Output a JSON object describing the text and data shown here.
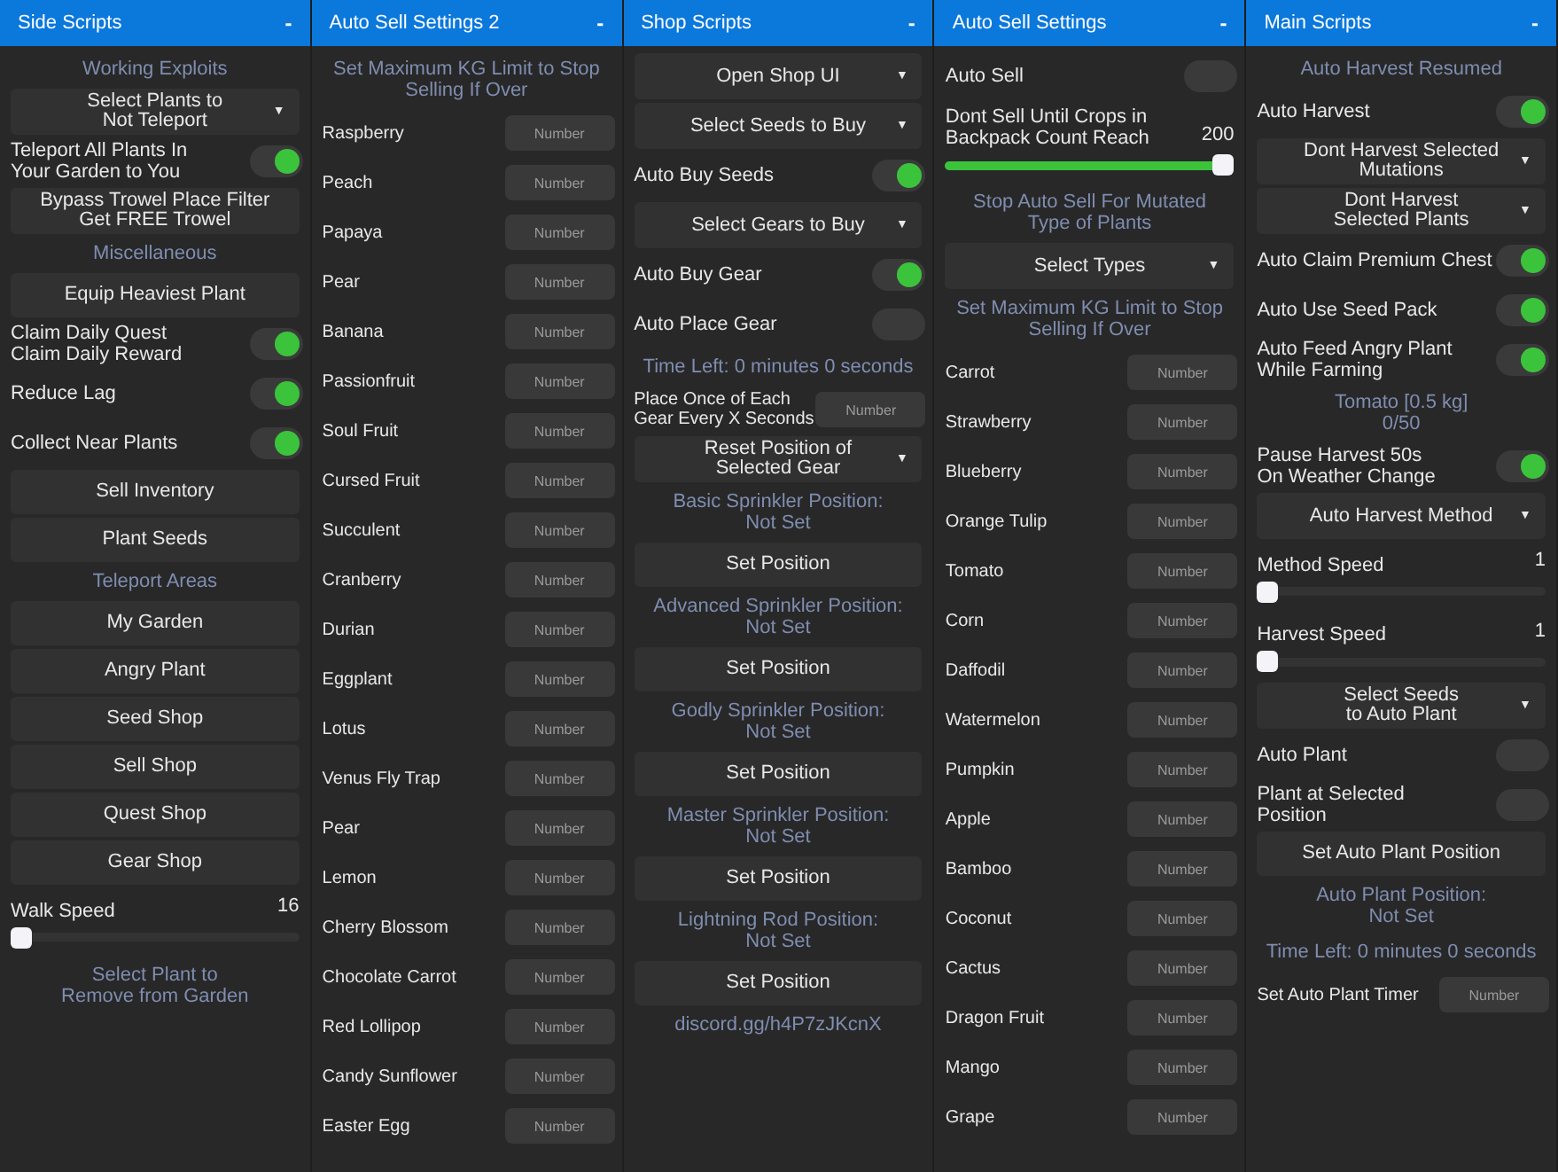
{
  "panels": [
    {
      "title": "Side Scripts",
      "collapse": "-",
      "items": [
        {
          "kind": "section",
          "text": "Working Exploits"
        },
        {
          "kind": "dropdown",
          "label": "Select Plants to\nNot Teleport",
          "caret": "▼"
        },
        {
          "kind": "toggle",
          "label": "Teleport All Plants In\nYour Garden to You",
          "on": true
        },
        {
          "kind": "button",
          "label": "Bypass Trowel Place Filter\nGet FREE Trowel"
        },
        {
          "kind": "section",
          "text": "Miscellaneous"
        },
        {
          "kind": "button",
          "label": "Equip Heaviest Plant"
        },
        {
          "kind": "toggle",
          "label": "Claim Daily Quest\nClaim Daily Reward",
          "on": true
        },
        {
          "kind": "toggle",
          "label": "Reduce Lag",
          "on": true
        },
        {
          "kind": "toggle",
          "label": "Collect Near Plants",
          "on": true
        },
        {
          "kind": "button",
          "label": "Sell Inventory"
        },
        {
          "kind": "button",
          "label": "Plant Seeds"
        },
        {
          "kind": "section",
          "text": "Teleport Areas"
        },
        {
          "kind": "button",
          "label": "My Garden"
        },
        {
          "kind": "button",
          "label": "Angry Plant"
        },
        {
          "kind": "button",
          "label": "Seed Shop"
        },
        {
          "kind": "button",
          "label": "Sell Shop"
        },
        {
          "kind": "button",
          "label": "Quest Shop"
        },
        {
          "kind": "button",
          "label": "Gear Shop"
        },
        {
          "kind": "slider",
          "label": "Walk Speed",
          "reading": "16",
          "level": 0
        },
        {
          "kind": "section",
          "text": "Select Plant to\nRemove from Garden"
        }
      ]
    },
    {
      "title": "Auto Sell Settings 2",
      "collapse": "-",
      "items": [
        {
          "kind": "section",
          "text": "Set Maximum KG Limit to Stop\nSelling If Over"
        },
        {
          "kind": "number",
          "label": "Raspberry",
          "placeholder": "Number"
        },
        {
          "kind": "number",
          "label": "Peach",
          "placeholder": "Number"
        },
        {
          "kind": "number",
          "label": "Papaya",
          "placeholder": "Number"
        },
        {
          "kind": "number",
          "label": "Pear",
          "placeholder": "Number"
        },
        {
          "kind": "number",
          "label": "Banana",
          "placeholder": "Number"
        },
        {
          "kind": "number",
          "label": "Passionfruit",
          "placeholder": "Number"
        },
        {
          "kind": "number",
          "label": "Soul Fruit",
          "placeholder": "Number"
        },
        {
          "kind": "number",
          "label": "Cursed Fruit",
          "placeholder": "Number"
        },
        {
          "kind": "number",
          "label": "Succulent",
          "placeholder": "Number"
        },
        {
          "kind": "number",
          "label": "Cranberry",
          "placeholder": "Number"
        },
        {
          "kind": "number",
          "label": "Durian",
          "placeholder": "Number"
        },
        {
          "kind": "number",
          "label": "Eggplant",
          "placeholder": "Number"
        },
        {
          "kind": "number",
          "label": "Lotus",
          "placeholder": "Number"
        },
        {
          "kind": "number",
          "label": "Venus Fly Trap",
          "placeholder": "Number"
        },
        {
          "kind": "number",
          "label": "Pear",
          "placeholder": "Number"
        },
        {
          "kind": "number",
          "label": "Lemon",
          "placeholder": "Number"
        },
        {
          "kind": "number",
          "label": "Cherry Blossom",
          "placeholder": "Number"
        },
        {
          "kind": "number",
          "label": "Chocolate Carrot",
          "placeholder": "Number"
        },
        {
          "kind": "number",
          "label": "Red Lollipop",
          "placeholder": "Number"
        },
        {
          "kind": "number",
          "label": "Candy Sunflower",
          "placeholder": "Number"
        },
        {
          "kind": "number",
          "label": "Easter Egg",
          "placeholder": "Number"
        }
      ]
    },
    {
      "title": "Shop Scripts",
      "collapse": "-",
      "items": [
        {
          "kind": "dropdown",
          "label": "Open Shop UI",
          "caret": "▼"
        },
        {
          "kind": "dropdown",
          "label": "Select Seeds to Buy",
          "caret": "▼"
        },
        {
          "kind": "toggle",
          "label": "Auto Buy Seeds",
          "on": true
        },
        {
          "kind": "dropdown",
          "label": "Select Gears to Buy",
          "caret": "▼"
        },
        {
          "kind": "toggle",
          "label": "Auto Buy Gear",
          "on": true
        },
        {
          "kind": "toggle",
          "label": "Auto Place Gear",
          "on": false
        },
        {
          "kind": "section",
          "text": "Time Left: 0 minutes 0 seconds"
        },
        {
          "kind": "number",
          "label": "Place Once of Each\nGear Every X Seconds",
          "placeholder": "Number"
        },
        {
          "kind": "dropdown",
          "label": "Reset Position of\nSelected Gear",
          "caret": "▼"
        },
        {
          "kind": "section",
          "text": "Basic Sprinkler Position:\nNot Set"
        },
        {
          "kind": "button",
          "label": "Set Position"
        },
        {
          "kind": "section",
          "text": "Advanced Sprinkler Position:\nNot Set"
        },
        {
          "kind": "button",
          "label": "Set Position"
        },
        {
          "kind": "section",
          "text": "Godly Sprinkler Position:\nNot Set"
        },
        {
          "kind": "button",
          "label": "Set Position"
        },
        {
          "kind": "section",
          "text": "Master Sprinkler Position:\nNot Set"
        },
        {
          "kind": "button",
          "label": "Set Position"
        },
        {
          "kind": "section",
          "text": "Lightning Rod Position:\nNot Set"
        },
        {
          "kind": "button",
          "label": "Set Position"
        },
        {
          "kind": "section",
          "text": "discord.gg/h4P7zJKcnX"
        }
      ]
    },
    {
      "title": "Auto Sell Settings",
      "collapse": "-",
      "items": [
        {
          "kind": "toggle",
          "label": "Auto Sell",
          "on": false
        },
        {
          "kind": "slider",
          "label": "Dont Sell Until Crops in\nBackpack Count Reach",
          "reading": "200",
          "level": 1
        },
        {
          "kind": "section",
          "text": "Stop Auto Sell For Mutated\nType of Plants"
        },
        {
          "kind": "dropdown",
          "label": "Select Types",
          "caret": "▼"
        },
        {
          "kind": "section",
          "text": "Set Maximum KG Limit to Stop\nSelling If Over"
        },
        {
          "kind": "number",
          "label": "Carrot",
          "placeholder": "Number"
        },
        {
          "kind": "number",
          "label": "Strawberry",
          "placeholder": "Number"
        },
        {
          "kind": "number",
          "label": "Blueberry",
          "placeholder": "Number"
        },
        {
          "kind": "number",
          "label": "Orange Tulip",
          "placeholder": "Number"
        },
        {
          "kind": "number",
          "label": "Tomato",
          "placeholder": "Number"
        },
        {
          "kind": "number",
          "label": "Corn",
          "placeholder": "Number"
        },
        {
          "kind": "number",
          "label": "Daffodil",
          "placeholder": "Number"
        },
        {
          "kind": "number",
          "label": "Watermelon",
          "placeholder": "Number"
        },
        {
          "kind": "number",
          "label": "Pumpkin",
          "placeholder": "Number"
        },
        {
          "kind": "number",
          "label": "Apple",
          "placeholder": "Number"
        },
        {
          "kind": "number",
          "label": "Bamboo",
          "placeholder": "Number"
        },
        {
          "kind": "number",
          "label": "Coconut",
          "placeholder": "Number"
        },
        {
          "kind": "number",
          "label": "Cactus",
          "placeholder": "Number"
        },
        {
          "kind": "number",
          "label": "Dragon Fruit",
          "placeholder": "Number"
        },
        {
          "kind": "number",
          "label": "Mango",
          "placeholder": "Number"
        },
        {
          "kind": "number",
          "label": "Grape",
          "placeholder": "Number"
        }
      ]
    },
    {
      "title": "Main Scripts",
      "collapse": "-",
      "items": [
        {
          "kind": "section",
          "text": "Auto Harvest Resumed"
        },
        {
          "kind": "toggle",
          "label": "Auto Harvest",
          "on": true
        },
        {
          "kind": "dropdown",
          "label": "Dont Harvest Selected\nMutations",
          "caret": "▼"
        },
        {
          "kind": "dropdown",
          "label": "Dont Harvest\nSelected Plants",
          "caret": "▼"
        },
        {
          "kind": "toggle",
          "label": "Auto Claim Premium Chest",
          "on": true
        },
        {
          "kind": "toggle",
          "label": "Auto Use Seed Pack",
          "on": true
        },
        {
          "kind": "toggle",
          "label": "Auto Feed Angry Plant\nWhile Farming",
          "on": true
        },
        {
          "kind": "section",
          "text": "Tomato [0.5 kg]\n0/50"
        },
        {
          "kind": "toggle",
          "label": "Pause Harvest 50s\nOn Weather Change",
          "on": true
        },
        {
          "kind": "dropdown",
          "label": "Auto Harvest Method",
          "caret": "▼"
        },
        {
          "kind": "slider",
          "label": "Method Speed",
          "reading": "1",
          "level": 0
        },
        {
          "kind": "slider",
          "label": "Harvest Speed",
          "reading": "1",
          "level": 0
        },
        {
          "kind": "dropdown",
          "label": "Select Seeds\nto Auto Plant",
          "caret": "▼"
        },
        {
          "kind": "toggle",
          "label": "Auto Plant",
          "on": false
        },
        {
          "kind": "toggle",
          "label": "Plant at Selected\nPosition",
          "on": false
        },
        {
          "kind": "button",
          "label": "Set Auto Plant Position"
        },
        {
          "kind": "section",
          "text": "Auto Plant Position:\nNot Set"
        },
        {
          "kind": "section",
          "text": "Time Left: 0 minutes 0 seconds"
        },
        {
          "kind": "number",
          "label": "Set Auto Plant Timer",
          "placeholder": "Number"
        }
      ]
    }
  ]
}
